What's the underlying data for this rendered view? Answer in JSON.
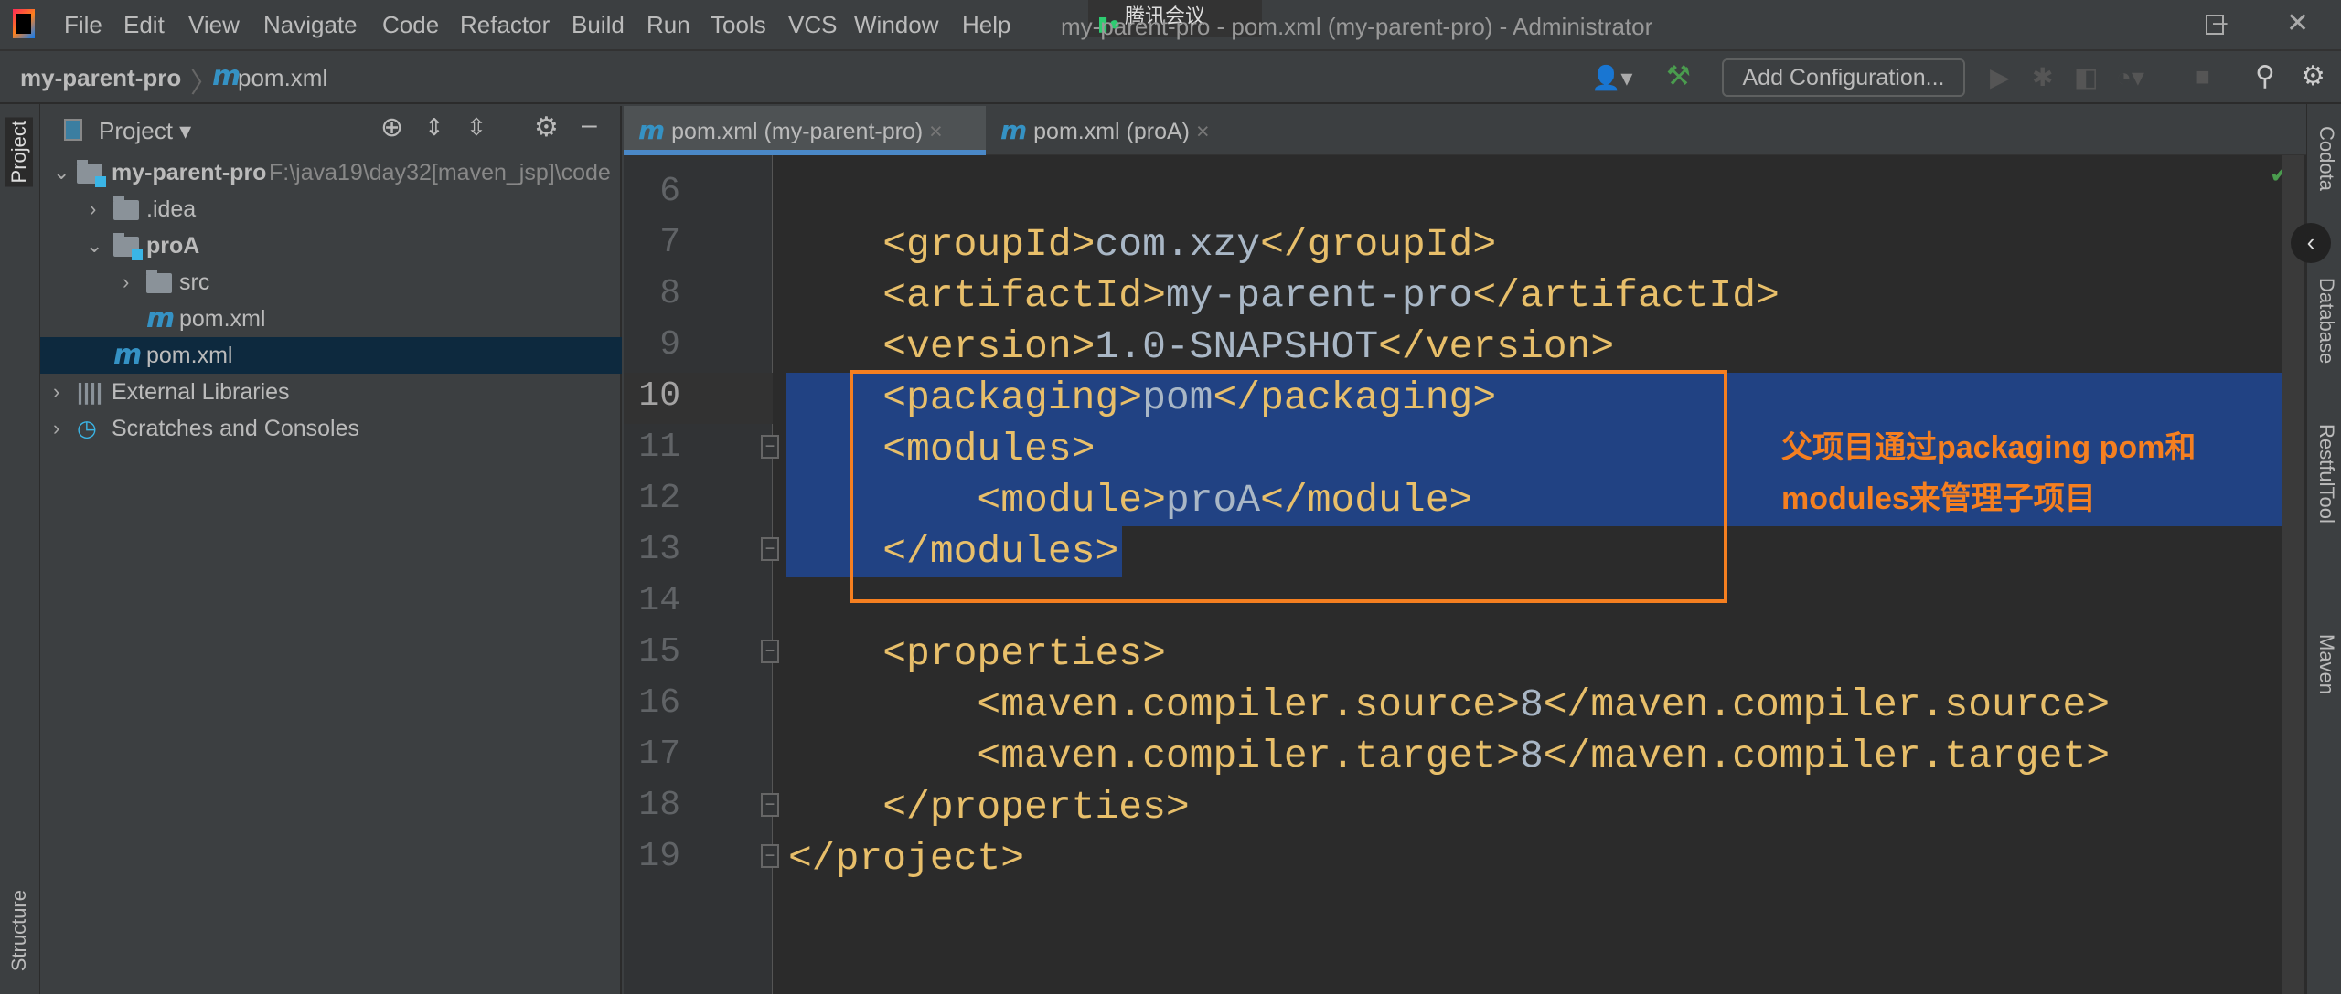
{
  "window": {
    "title": "my-parent-pro - pom.xml (my-parent-pro) - Administrator",
    "overlay": "腾讯会议"
  },
  "menu": [
    "File",
    "Edit",
    "View",
    "Navigate",
    "Code",
    "Refactor",
    "Build",
    "Run",
    "Tools",
    "VCS",
    "Window",
    "Help"
  ],
  "breadcrumb": {
    "project": "my-parent-pro",
    "file": "pom.xml"
  },
  "toolbar": {
    "config_label": "Add Configuration..."
  },
  "project_panel": {
    "title": "Project",
    "tree": [
      {
        "label": "my-parent-pro",
        "path": "F:\\java19\\day32[maven_jsp]\\code"
      },
      {
        "label": ".idea"
      },
      {
        "label": "proA"
      },
      {
        "label": "src"
      },
      {
        "label": "pom.xml"
      },
      {
        "label": "pom.xml"
      },
      {
        "label": "External Libraries"
      },
      {
        "label": "Scratches and Consoles"
      }
    ]
  },
  "left_stripe": {
    "project": "Project",
    "structure": "Structure"
  },
  "right_stripe": [
    "Codota",
    "Database",
    "RestfulTool",
    "Maven"
  ],
  "tabs": [
    {
      "label": "pom.xml (my-parent-pro)",
      "active": true
    },
    {
      "label": "pom.xml (proA)",
      "active": false
    }
  ],
  "code": [
    {
      "n": "6",
      "parts": []
    },
    {
      "n": "7",
      "parts": [
        [
          "t",
          "    <groupId>"
        ],
        [
          "v",
          "com.xzy"
        ],
        [
          "t",
          "</groupId>"
        ]
      ]
    },
    {
      "n": "8",
      "parts": [
        [
          "t",
          "    <artifactId>"
        ],
        [
          "v",
          "my-parent-pro"
        ],
        [
          "t",
          "</artifactId>"
        ]
      ]
    },
    {
      "n": "9",
      "parts": [
        [
          "t",
          "    <version>"
        ],
        [
          "v",
          "1.0-SNAPSHOT"
        ],
        [
          "t",
          "</version>"
        ]
      ]
    },
    {
      "n": "10",
      "parts": [
        [
          "t",
          "    <packaging>"
        ],
        [
          "v",
          "pom"
        ],
        [
          "t",
          "</packaging>"
        ]
      ]
    },
    {
      "n": "11",
      "parts": [
        [
          "t",
          "    <modules>"
        ]
      ]
    },
    {
      "n": "12",
      "parts": [
        [
          "t",
          "        <module>"
        ],
        [
          "v",
          "proA"
        ],
        [
          "t",
          "</module>"
        ]
      ]
    },
    {
      "n": "13",
      "parts": [
        [
          "t",
          "    </modules>"
        ]
      ]
    },
    {
      "n": "14",
      "parts": []
    },
    {
      "n": "15",
      "parts": [
        [
          "t",
          "    <properties>"
        ]
      ]
    },
    {
      "n": "16",
      "parts": [
        [
          "t",
          "        <maven.compiler.source>"
        ],
        [
          "v",
          "8"
        ],
        [
          "t",
          "</maven.compiler.source>"
        ]
      ]
    },
    {
      "n": "17",
      "parts": [
        [
          "t",
          "        <maven.compiler.target>"
        ],
        [
          "v",
          "8"
        ],
        [
          "t",
          "</maven.compiler.target>"
        ]
      ]
    },
    {
      "n": "18",
      "parts": [
        [
          "t",
          "    </properties>"
        ]
      ]
    },
    {
      "n": "19",
      "parts": [
        [
          "t",
          "</project>"
        ]
      ]
    }
  ],
  "annotation": {
    "line1": "父项目通过packaging  pom和",
    "line2": "modules来管理子项目",
    "color": "#f57f20"
  },
  "colors": {
    "tag": "#e8bf6a",
    "value": "#a9b7c6",
    "selection": "#214283",
    "accent": "#4a88c7"
  }
}
